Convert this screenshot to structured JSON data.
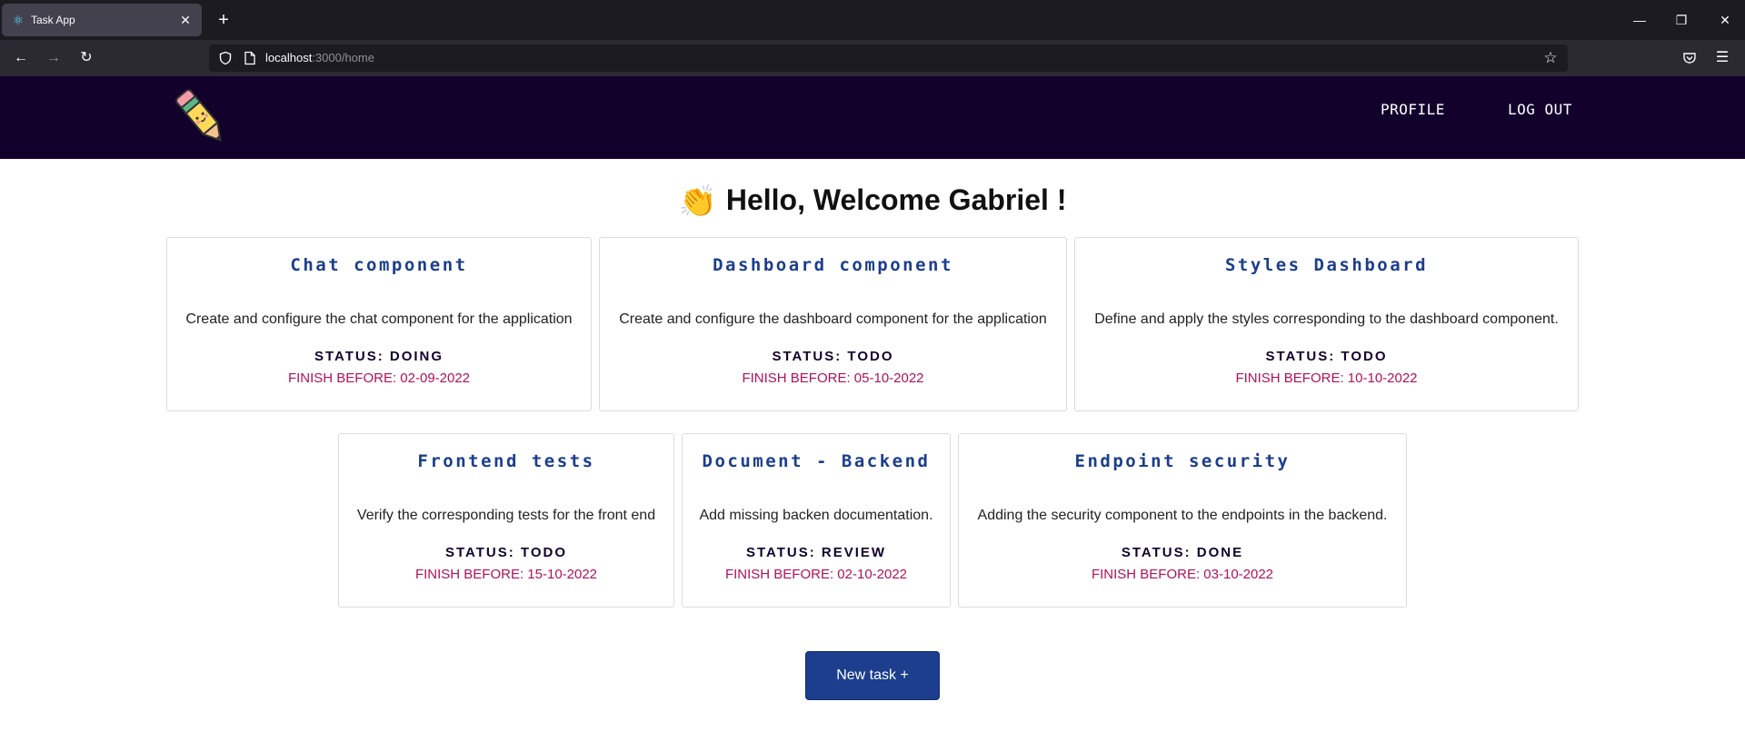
{
  "browser": {
    "tab_title": "Task App",
    "url_host": "localhost",
    "url_rest": ":3000/home"
  },
  "header": {
    "profile_label": "PROFILE",
    "logout_label": "LOG OUT"
  },
  "welcome": {
    "wave": "👏",
    "text": "Hello, Welcome Gabriel !"
  },
  "tasks": [
    {
      "title": "Chat component",
      "description": "Create and configure the chat component for the application",
      "status": "STATUS: DOING",
      "finish": "FINISH BEFORE: 02-09-2022"
    },
    {
      "title": "Dashboard component",
      "description": "Create and configure the dashboard component for the application",
      "status": "STATUS: TODO",
      "finish": "FINISH BEFORE: 05-10-2022"
    },
    {
      "title": "Styles Dashboard",
      "description": "Define and apply the styles corresponding to the dashboard component.",
      "status": "STATUS: TODO",
      "finish": "FINISH BEFORE: 10-10-2022"
    },
    {
      "title": "Frontend tests",
      "description": "Verify the corresponding tests for the front end",
      "status": "STATUS: TODO",
      "finish": "FINISH BEFORE: 15-10-2022"
    },
    {
      "title": "Document - Backend",
      "description": "Add missing backen documentation.",
      "status": "STATUS: REVIEW",
      "finish": "FINISH BEFORE: 02-10-2022"
    },
    {
      "title": "Endpoint security",
      "description": "Adding the security component to the endpoints in the backend.",
      "status": "STATUS: DONE",
      "finish": "FINISH BEFORE: 03-10-2022"
    }
  ],
  "new_task_label": "New task +",
  "icons": {
    "tab_favicon": "react-icon",
    "logo": "pencil-logo-icon"
  },
  "colors": {
    "header_bg": "#12012b",
    "title_blue": "#1c3e8c",
    "date_red": "#b0125a",
    "button_bg": "#1c3e8c"
  }
}
